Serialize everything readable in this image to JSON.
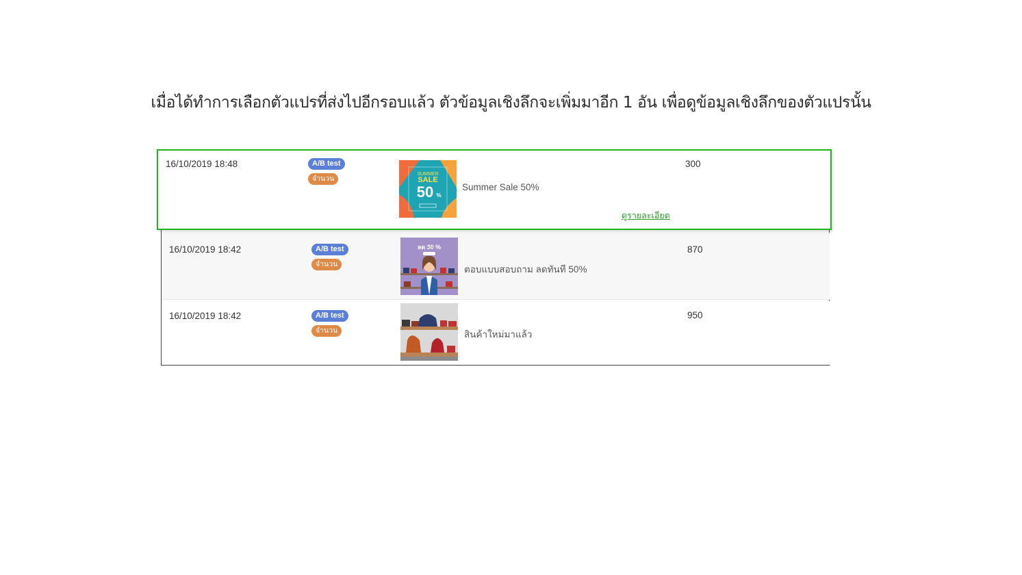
{
  "instruction": "เมื่อได้ทำการเลือกตัวแปรที่ส่งไปอีกรอบแล้ว ตัวข้อมูลเชิงลึกจะเพิ่มมาอีก 1 อัน เพื่อดูข้อมูลเชิงลึกของตัวแปรนั้น",
  "rows": [
    {
      "date": "16/10/2019 18:48",
      "badge_primary": "A/B test",
      "badge_secondary": "จำนวน",
      "thumbnail_icon": "summer-sale-banner",
      "thumbnail_text": {
        "top": "SUMMER",
        "mid": "SALE",
        "pct": "50",
        "pct_sign": "%"
      },
      "title": "Summer Sale 50%",
      "count": "300",
      "detail_link": "ดูรายละเอียด"
    },
    {
      "date": "16/10/2019 18:42",
      "badge_primary": "A/B test",
      "badge_secondary": "จำนวน",
      "thumbnail_icon": "woman-shop-banner",
      "thumbnail_text": {
        "top": "ลด 30 %"
      },
      "title": "ตอบแบบสอบถาม ลดทันที 50%",
      "count": "870"
    },
    {
      "date": "16/10/2019 18:42",
      "badge_primary": "A/B test",
      "badge_secondary": "จำนวน",
      "thumbnail_icon": "bags-shelf-banner",
      "title": "สินค้าใหม่มาแล้ว",
      "count": "950"
    }
  ],
  "colors": {
    "highlight_border": "#22b322",
    "badge_ab": "#5b7ed6",
    "badge_qty": "#e08a48",
    "link": "#2a9a2a"
  }
}
